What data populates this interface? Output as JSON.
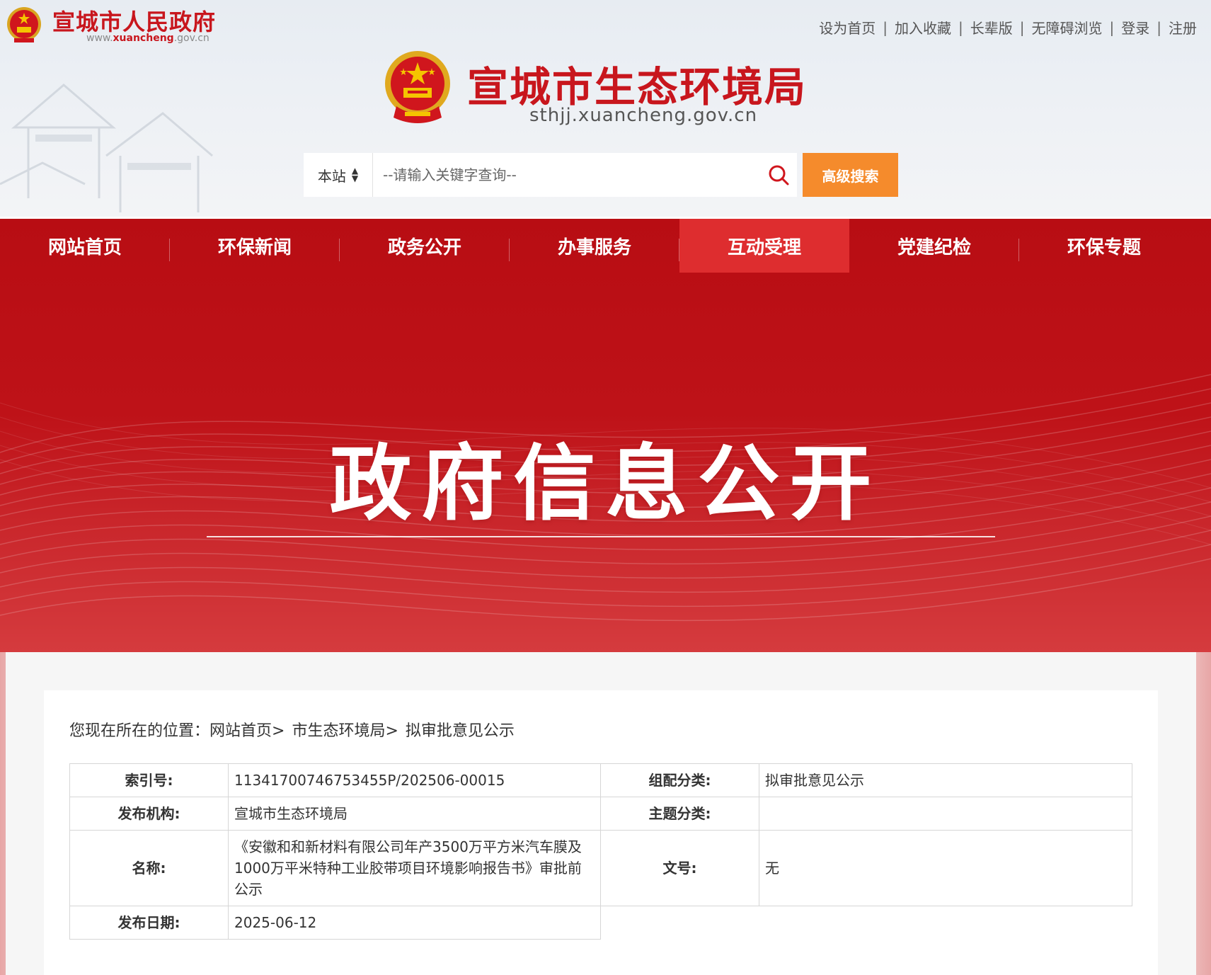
{
  "header": {
    "gov_name": "宣城市人民政府",
    "gov_domain_prefix": "www.",
    "gov_domain_main": "xuancheng",
    "gov_domain_suffix": ".gov.cn",
    "site_title": "宣城市生态环境局",
    "site_domain": "sthjj.xuancheng.gov.cn",
    "top_links": [
      "设为首页",
      "加入收藏",
      "长辈版",
      "无障碍浏览",
      "登录",
      "注册"
    ]
  },
  "search": {
    "scope_label": "本站",
    "placeholder": "--请输入关键字查询--",
    "advanced_label": "高级搜索"
  },
  "nav": {
    "items": [
      "网站首页",
      "环保新闻",
      "政务公开",
      "办事服务",
      "互动受理",
      "党建纪检",
      "环保专题"
    ],
    "active": "互动受理"
  },
  "banner": {
    "title": "政府信息公开"
  },
  "breadcrumb": {
    "prefix": "您现在所在的位置：",
    "items": [
      "网站首页>",
      "市生态环境局>",
      "拟审批意见公示"
    ]
  },
  "meta_table": {
    "index_label": "索引号:",
    "index_value": "11341700746753455P/202506-00015",
    "category_label": "组配分类:",
    "category_value": "拟审批意见公示",
    "publisher_label": "发布机构:",
    "publisher_value": "宣城市生态环境局",
    "topic_label": "主题分类:",
    "topic_value": "",
    "name_label": "名称:",
    "name_value": "《安徽和和新材料有限公司年产3500万平方米汽车膜及1000万平米特种工业胶带项目环境影响报告书》审批前公示",
    "doc_no_label": "文号:",
    "doc_no_value": "无",
    "date_label": "发布日期:",
    "date_value": "2025-06-12"
  },
  "colors": {
    "brand_red": "#c8161d",
    "nav_active": "#de2d2f",
    "search_button": "#f58b2c"
  }
}
